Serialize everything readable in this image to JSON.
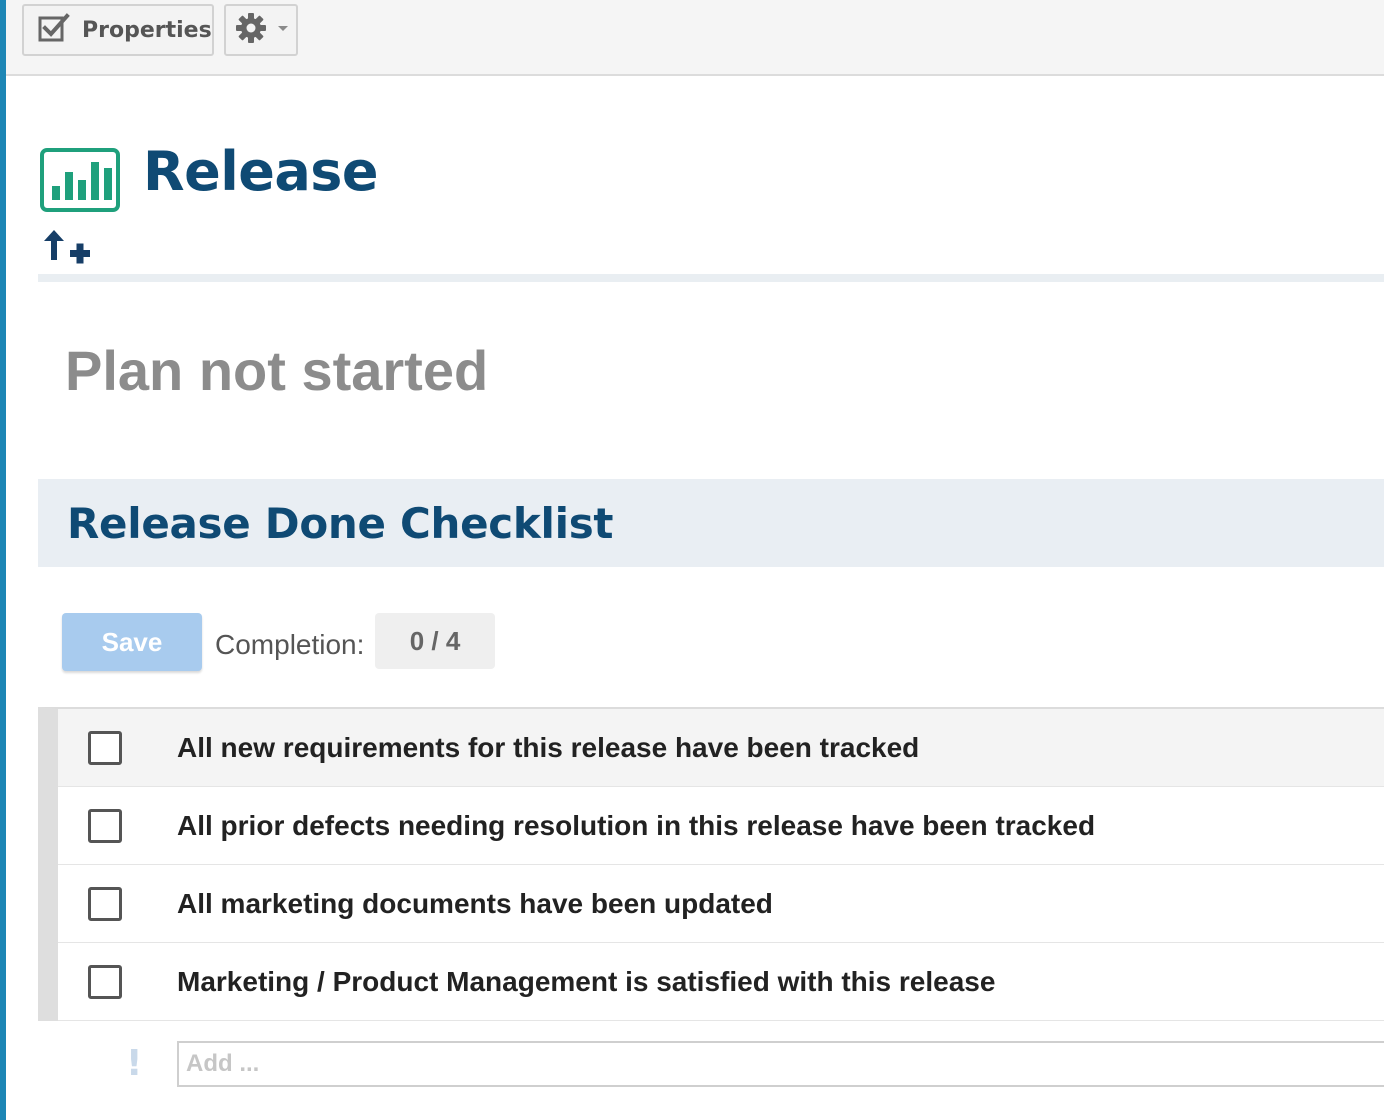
{
  "toolbar": {
    "properties_label": "Properties",
    "properties_icon": "checkbox-edit-icon",
    "settings_icon": "gear-icon"
  },
  "header": {
    "title": "Release",
    "icon": "bar-chart-icon",
    "action_icon": "up-arrow-plus-icon"
  },
  "plan": {
    "status": "Plan not started"
  },
  "checklist": {
    "title": "Release Done Checklist",
    "save_label": "Save",
    "completion_label": "Completion:",
    "completion_value": "0 / 4",
    "items": [
      {
        "label": "All new requirements for this release have been tracked",
        "checked": false
      },
      {
        "label": "All prior defects needing resolution in this release have been tracked",
        "checked": false
      },
      {
        "label": "All marketing documents have been updated",
        "checked": false
      },
      {
        "label": "Marketing / Product Management is satisfied with this release",
        "checked": false
      }
    ],
    "add_placeholder": "Add ...",
    "add_icon": "exclamation-icon"
  },
  "colors": {
    "accent_bar": "#1d86b5",
    "title_blue": "#0f4a74",
    "icon_green": "#1fa07c",
    "save_button": "#a8cbee"
  }
}
